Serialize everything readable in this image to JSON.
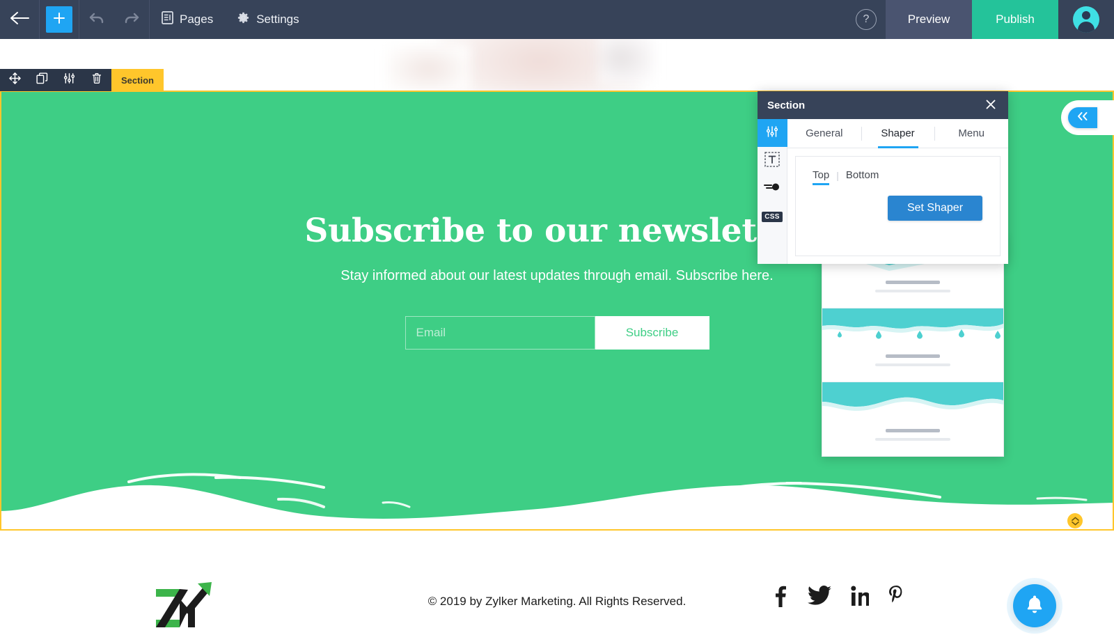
{
  "toolbar": {
    "back_icon": "arrow-left-icon",
    "add_icon": "plus-icon",
    "undo_icon": "undo-icon",
    "redo_icon": "redo-icon",
    "pages_label": "Pages",
    "pages_icon": "pages-icon",
    "settings_label": "Settings",
    "settings_icon": "gear-icon",
    "help_label": "?",
    "preview_label": "Preview",
    "publish_label": "Publish",
    "avatar_icon": "user-avatar-icon",
    "accent_blue": "#1fa5f3",
    "publish_green": "#24c39a",
    "bar_bg": "#374359"
  },
  "section_toolbar": {
    "move_icon": "move-icon",
    "duplicate_icon": "duplicate-icon",
    "settings_icon": "sliders-icon",
    "delete_icon": "trash-icon",
    "label": "Section",
    "highlight_color": "#ffc62b"
  },
  "canvas": {
    "section_bg": "#3ece85",
    "newsletter": {
      "title": "Subscribe to our newsletter",
      "subtitle": "Stay informed about our latest updates through email. Subscribe here.",
      "email_placeholder": "Email",
      "email_value": "",
      "submit_label": "Subscribe"
    },
    "collapse_icon": "chevron-double-left-icon",
    "resize_handle_icon": "resize-vertical-icon"
  },
  "footer": {
    "logo_icon": "zylker-marketing-logo",
    "copyright": "© 2019 by Zylker Marketing. All Rights Reserved.",
    "social": [
      {
        "name": "facebook-icon",
        "label": "f"
      },
      {
        "name": "twitter-icon",
        "label": "t"
      },
      {
        "name": "linkedin-icon",
        "label": "in"
      },
      {
        "name": "pinterest-icon",
        "label": "p"
      }
    ],
    "notification_icon": "bell-icon"
  },
  "panel": {
    "title": "Section",
    "close_icon": "close-icon",
    "rail": [
      {
        "icon": "sliders-icon",
        "active": true
      },
      {
        "icon": "text-box-icon",
        "active": false
      },
      {
        "icon": "animation-icon",
        "active": false
      },
      {
        "icon": "css-icon",
        "label": "CSS",
        "active": false
      }
    ],
    "tabs": [
      {
        "label": "General",
        "active": false
      },
      {
        "label": "Shaper",
        "active": true
      },
      {
        "label": "Menu",
        "active": false
      }
    ],
    "shaper": {
      "position_tabs": [
        {
          "label": "Top",
          "active": true
        },
        {
          "label": "Bottom",
          "active": false
        }
      ],
      "set_button_label": "Set Shaper",
      "button_color": "#2a85d0"
    },
    "shaper_options": [
      {
        "name": "shaper-thin-triangle-wave",
        "color": "#4ed0d0"
      },
      {
        "name": "shaper-drip-droplets",
        "color": "#4ed0d0"
      },
      {
        "name": "shaper-soft-wave",
        "color": "#4ed0d0"
      }
    ]
  }
}
